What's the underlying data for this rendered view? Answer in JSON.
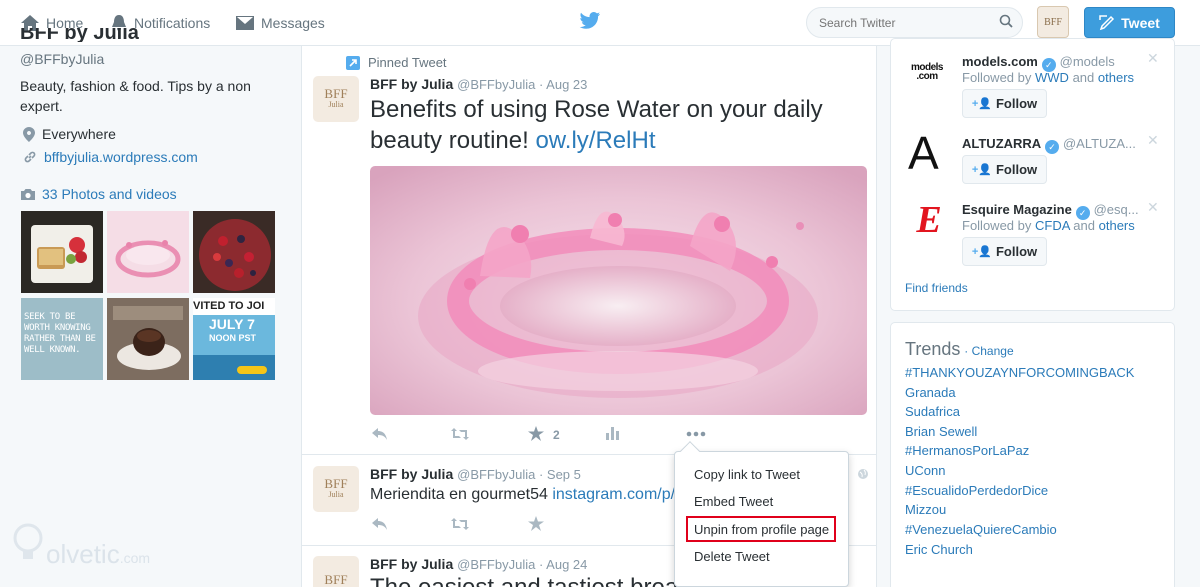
{
  "nav": {
    "home": "Home",
    "notifications": "Notifications",
    "messages": "Messages",
    "search_placeholder": "Search Twitter",
    "tweet_button": "Tweet"
  },
  "profile": {
    "name": "BFF by Julia",
    "handle": "@BFFbyJulia",
    "bio": "Beauty, fashion & food. Tips by a non expert.",
    "location": "Everywhere",
    "website": "bffbyjulia.wordpress.com",
    "photos_link": "33 Photos and videos",
    "thumb5_text": "SEEK TO BE WORTH KNOWING RATHER THAN BE WELL KNOWN.",
    "thumb7_line1": "VITED TO JOI",
    "thumb7_line2": "JULY 7",
    "thumb7_line3": "NOON PST"
  },
  "tweets": [
    {
      "pinned_label": "Pinned Tweet",
      "avatar_text": "BFF",
      "avatar_sub": "Julia",
      "name": "BFF by Julia",
      "handle_date": "@BFFbyJulia · Aug 23",
      "text": "Benefits of using Rose Water on your daily beauty routine!",
      "link": "ow.ly/RelHt",
      "favorites": "2"
    },
    {
      "avatar_text": "BFF",
      "avatar_sub": "Julia",
      "name": "BFF by Julia",
      "handle_date": "@BFFbyJulia · Sep 5",
      "text": "Meriendita en gourmet54",
      "link": "instagram.com/p/"
    },
    {
      "avatar_text": "BFF",
      "name": "BFF by Julia",
      "handle_date": "@BFFbyJulia · Aug 24",
      "text": "The easiest and tastiest breakfast sandwich!"
    }
  ],
  "dropdown": {
    "items": [
      "Copy link to Tweet",
      "Embed Tweet",
      "Unpin from profile page",
      "Delete Tweet"
    ],
    "highlight_color": "#e0001b"
  },
  "who_to_follow": [
    {
      "name": "models.com",
      "handle": "@models",
      "followed_prefix": "Followed by",
      "followed_by": "WWD",
      "and": "and",
      "others": "others",
      "logo": "models\n.com",
      "button": "Follow"
    },
    {
      "name": "ALTUZARRA",
      "handle": "@ALTUZA...",
      "logo": "A",
      "button": "Follow"
    },
    {
      "name": "Esquire Magazine",
      "handle": "@esq...",
      "followed_prefix": "Followed by",
      "followed_by": "CFDA",
      "and": "and",
      "others": "others",
      "logo": "E",
      "button": "Follow"
    }
  ],
  "find_friends": "Find friends",
  "trends": {
    "title": "Trends",
    "change": "· Change",
    "items": [
      "#THANKYOUZAYNFORCOMINGBACK",
      "Granada",
      "Sudafrica",
      "Brian Sewell",
      "#HermanosPorLaPaz",
      "UConn",
      "#EscualidoPerdedorDice",
      "Mizzou",
      "#VenezuelaQuiereCambio",
      "Eric Church"
    ]
  },
  "watermark": {
    "text": "olvetic",
    "suffix": ".com"
  },
  "colors": {
    "link": "#2b7bb9",
    "brand": "#55acee",
    "tweet_button": "#3d9ddd"
  }
}
